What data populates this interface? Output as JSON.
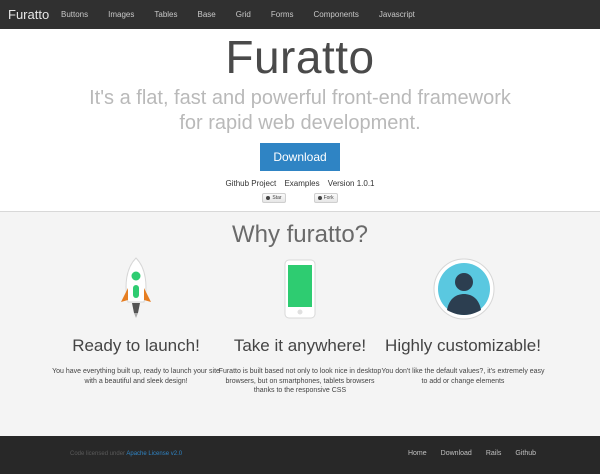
{
  "nav": {
    "brand": "Furatto",
    "items": [
      "Buttons",
      "Images",
      "Tables",
      "Base",
      "Grid",
      "Forms",
      "Components",
      "Javascript"
    ]
  },
  "hero": {
    "title": "Furatto",
    "subtitle": "It's a flat, fast and powerful front-end framework for rapid web development.",
    "download_label": "Download",
    "links": [
      "Github Project",
      "Examples",
      "Version 1.0.1"
    ],
    "star_label": "Star",
    "fork_label": "Fork"
  },
  "why": {
    "title": "Why furatto?"
  },
  "features": [
    {
      "title": "Ready to launch!",
      "text": "You have everything built up, ready to launch your site with a beautiful and sleek design!"
    },
    {
      "title": "Take it anywhere!",
      "text": "Furatto is built based not only to look nice in desktop browsers, but on smartphones, tablets browsers thanks to the responsive CSS"
    },
    {
      "title": "Highly customizable!",
      "text": "You don't like the default values?, it's extremely easy to add or change elements"
    }
  ],
  "footer": {
    "license_prefix": "Code licensed under ",
    "license_link": "Apache License v2.0",
    "links": [
      "Home",
      "Download",
      "Rails",
      "Github"
    ]
  },
  "colors": {
    "navbar": "#303030",
    "primary": "#2f84c4",
    "phone_screen": "#2ecc71",
    "avatar": "#5ac8e0",
    "footer": "#282828"
  }
}
